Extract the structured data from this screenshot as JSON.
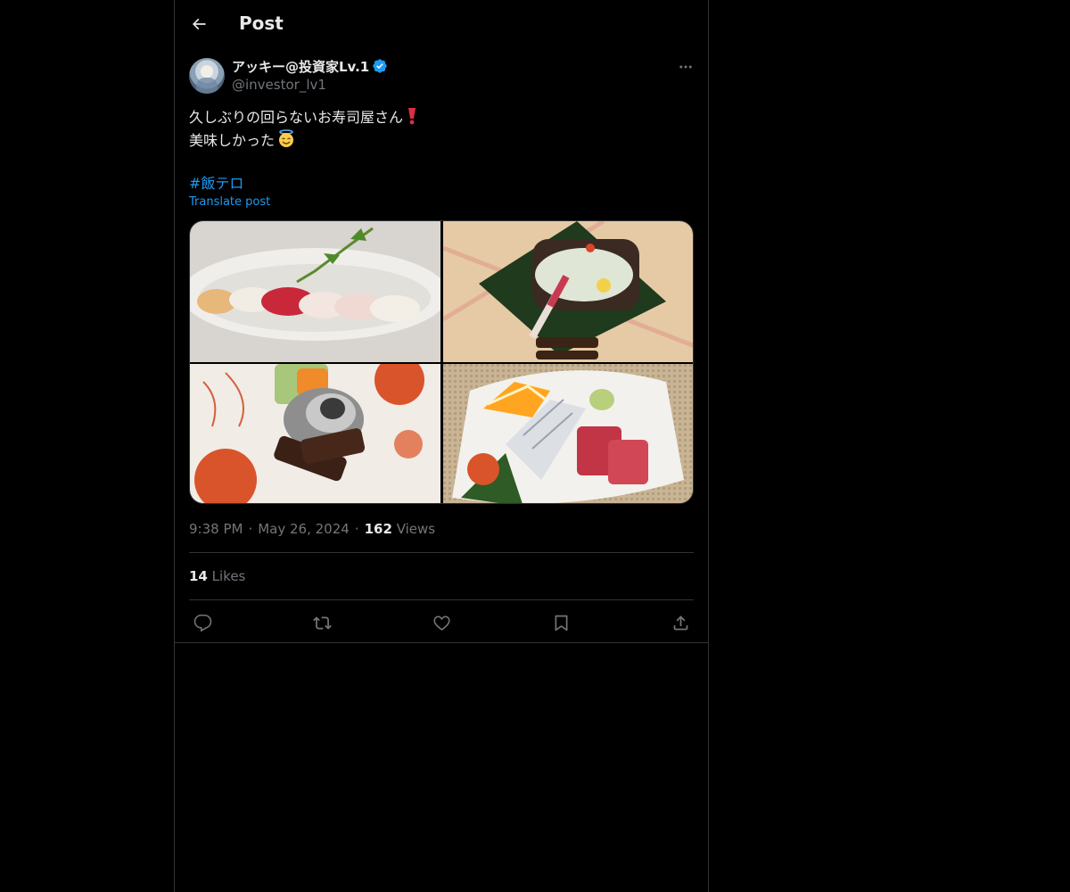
{
  "header": {
    "title": "Post",
    "back_icon": "arrow-left-icon"
  },
  "author": {
    "display_name": "アッキー@投資家Lv.1",
    "handle": "@investor_lv1",
    "verified_color": "#1d9bf0"
  },
  "post": {
    "line1": "久しぶりの回らないお寿司屋さん",
    "line1_emoji": "heavy-exclamation-mark-icon",
    "line2": "美味しかった",
    "line2_emoji": "smiling-face-with-halo-icon",
    "hashtag": "#飯テロ",
    "translate_label": "Translate post",
    "photos": [
      "nigiri-sushi-photo",
      "grilled-fish-photo",
      "appetizer-plate-photo",
      "sashimi-photo"
    ]
  },
  "meta": {
    "time": "9:38 PM",
    "separator": "·",
    "date": "May 26, 2024",
    "views_count": "162",
    "views_label": "Views"
  },
  "likes": {
    "count": "14",
    "label": "Likes"
  },
  "actions": [
    "reply-icon",
    "repost-icon",
    "like-icon",
    "bookmark-icon",
    "share-icon"
  ],
  "colors": {
    "background": "#000000",
    "text": "#e7e9ea",
    "secondary": "#71767b",
    "accent": "#1d9bf0",
    "border": "#2f3336"
  }
}
